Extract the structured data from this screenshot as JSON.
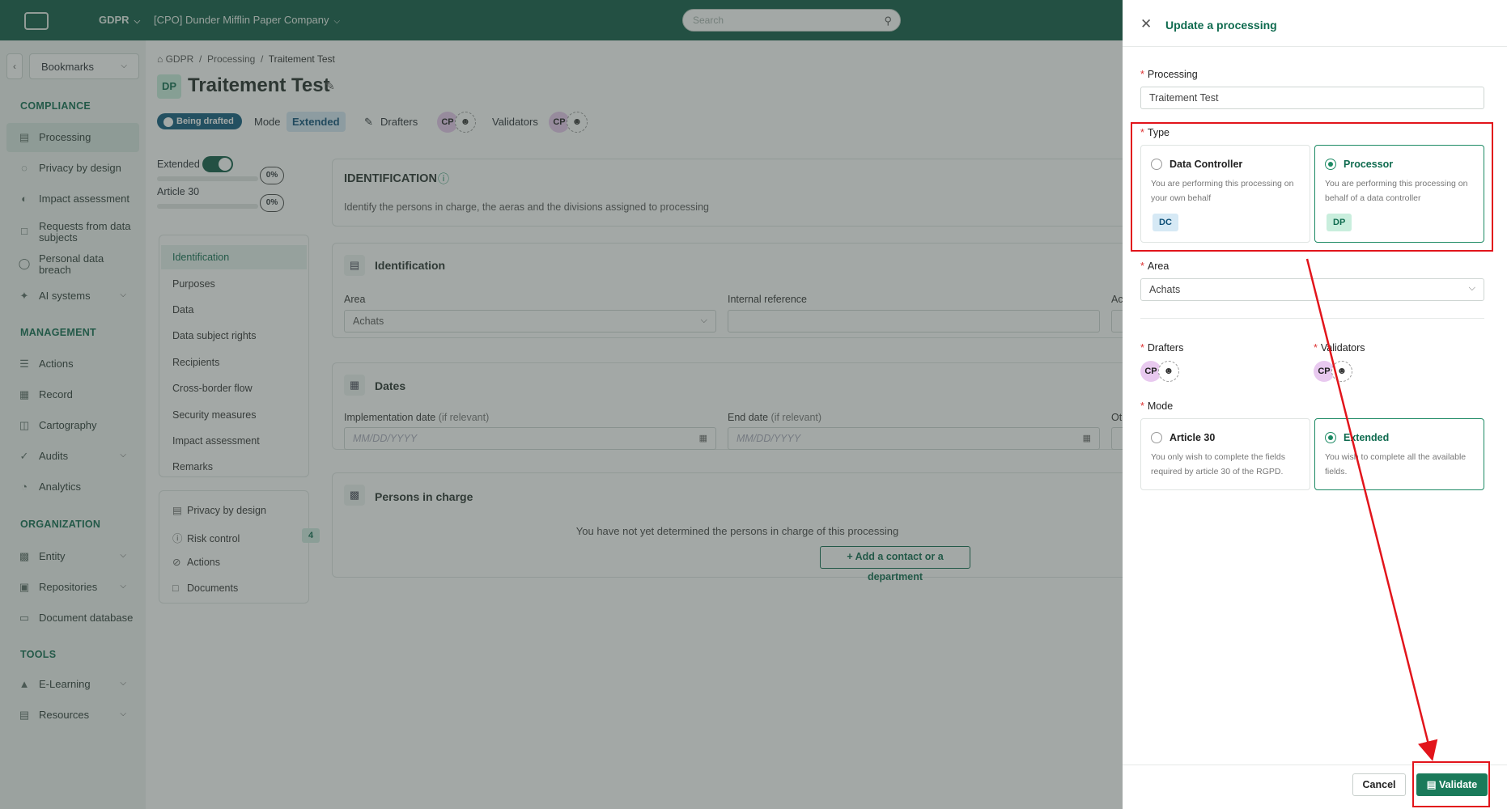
{
  "topbar": {
    "module": "GDPR",
    "company": "[CPO] Dunder Mifflin Paper Company",
    "search_placeholder": "Search"
  },
  "sidebar": {
    "bookmarks": "Bookmarks",
    "sections": {
      "compliance": "COMPLIANCE",
      "management": "MANAGEMENT",
      "organization": "ORGANIZATION",
      "tools": "TOOLS"
    },
    "items": {
      "processing": "Processing",
      "privacy_by_design": "Privacy by design",
      "impact_assessment": "Impact assessment",
      "requests": "Requests from data subjects",
      "breach": "Personal data breach",
      "ai_systems": "AI systems",
      "actions": "Actions",
      "record": "Record",
      "cartography": "Cartography",
      "audits": "Audits",
      "analytics": "Analytics",
      "entity": "Entity",
      "repositories": "Repositories",
      "document_database": "Document database",
      "elearning": "E-Learning",
      "resources": "Resources"
    }
  },
  "main": {
    "breadcrumb": {
      "root": "GDPR",
      "sep": "/",
      "section": "Processing",
      "current": "Traitement Test"
    },
    "badge": "DP",
    "title": "Traitement Test",
    "status": "Being drafted",
    "mode_label": "Mode",
    "mode_value": "Extended",
    "drafters_label": "Drafters",
    "validators_label": "Validators",
    "avatar": "CP",
    "progress": [
      {
        "label": "Extended",
        "value": "0%"
      },
      {
        "label": "Article 30",
        "value": "0%"
      }
    ],
    "subnav": [
      "Identification",
      "Purposes",
      "Data",
      "Data subject rights",
      "Recipients",
      "Cross-border flow",
      "Security measures",
      "Impact assessment",
      "Remarks"
    ],
    "subnav2": {
      "privacy": "Privacy by design",
      "risk": "Risk control",
      "risk_count": "4",
      "actions": "Actions",
      "documents": "Documents"
    },
    "intro": {
      "title": "IDENTIFICATION",
      "text": "Identify the persons in charge, the aeras and the divisions assigned to processing"
    },
    "identification": {
      "title": "Identification",
      "area_label": "Area",
      "area_value": "Achats",
      "ref_label": "Internal reference",
      "cut_label": "Ac"
    },
    "dates": {
      "title": "Dates",
      "impl_label": "Implementation date",
      "end_label": "End date",
      "relevant": "(if relevant)",
      "placeholder": "MM/DD/YYYY",
      "cut_label": "Oth"
    },
    "persons": {
      "title": "Persons in charge",
      "empty": "You have not yet determined the persons in charge of this processing",
      "add": "Add a contact or a department"
    }
  },
  "panel": {
    "title": "Update a processing",
    "processing_label": "Processing",
    "processing_value": "Traitement Test",
    "type_label": "Type",
    "type_options": [
      {
        "title": "Data Controller",
        "desc": "You are performing this processing on your own behalf",
        "badge": "DC"
      },
      {
        "title": "Processor",
        "desc": "You are performing this processing on behalf of a data controller",
        "badge": "DP"
      }
    ],
    "area_label": "Area",
    "area_value": "Achats",
    "drafters_label": "Drafters",
    "validators_label": "Validators",
    "avatar": "CP",
    "mode_label": "Mode",
    "mode_options": [
      {
        "title": "Article 30",
        "desc": "You only wish to complete the fields required by article 30 of the RGPD."
      },
      {
        "title": "Extended",
        "desc": "You wish to complete all the available fields."
      }
    ],
    "cancel": "Cancel",
    "validate": "Validate"
  },
  "colors": {
    "brand": "#0f5a44",
    "accent": "#1a7a5a",
    "annotation": "#e2141b"
  }
}
